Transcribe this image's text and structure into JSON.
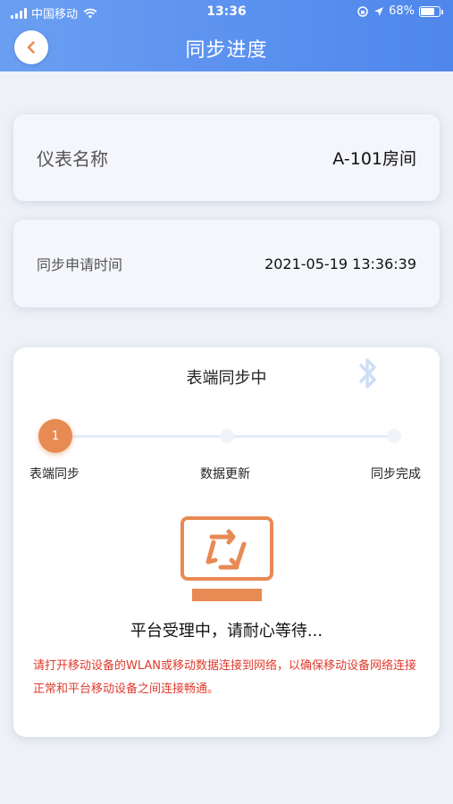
{
  "status_bar": {
    "carrier": "中国移动",
    "time": "13:36",
    "battery": "68%"
  },
  "header": {
    "title": "同步进度",
    "back_icon": "chevron-left-icon"
  },
  "meter_card": {
    "label": "仪表名称",
    "value": "A-101房间"
  },
  "time_card": {
    "label": "同步申请时间",
    "value": "2021-05-19 13:36:39"
  },
  "sync_card": {
    "title": "表端同步中",
    "steps": [
      {
        "number": "1",
        "label": "表端同步"
      },
      {
        "label": "数据更新"
      },
      {
        "label": "同步完成"
      }
    ],
    "wait_text": "平台受理中，请耐心等待...",
    "warning": "请打开移动设备的WLAN或移动数据连接到网络，以确保移动设备网络连接正常和平台移动设备之间连接畅通。"
  },
  "colors": {
    "header_start": "#6a9ff2",
    "header_end": "#4f86ec",
    "accent_orange": "#e88a53",
    "warning_red": "#e03a2c"
  }
}
